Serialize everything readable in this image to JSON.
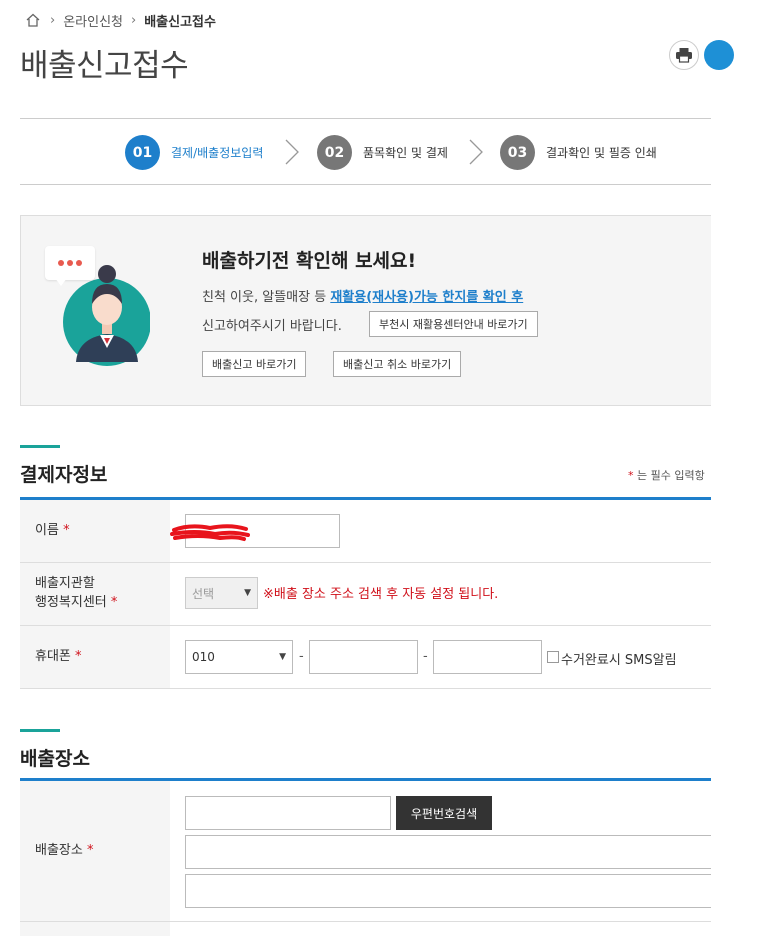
{
  "breadcrumb": {
    "home_icon": "home-icon",
    "items": [
      "온라인신청",
      "배출신고접수"
    ]
  },
  "page_title": "배출신고접수",
  "steps": [
    {
      "num": "01",
      "label": "결제/배출정보입력",
      "active": true
    },
    {
      "num": "02",
      "label": "품목확인 및 결제",
      "active": false
    },
    {
      "num": "03",
      "label": "결과확인 및 필증 인쇄",
      "active": false
    }
  ],
  "notice": {
    "title": "배출하기전 확인해 보세요!",
    "line1_prefix": "친척 이웃, 알뜰매장 등 ",
    "line1_link": "재활용(재사용)가능 한지를 확인 후",
    "line2": "신고하여주시기 바랍니다.",
    "recycle_center_button": "부천시 재활용센터안내 바로가기",
    "go_report_button": "배출신고 바로가기",
    "cancel_report_button": "배출신고 취소 바로가기"
  },
  "payer_section": {
    "title": "결제자정보",
    "required_star": "*",
    "required_note": " 는 필수 입력항",
    "name_label": "이름",
    "center_label_line1": "배출지관할",
    "center_label_line2": "행정복지센터",
    "center_select": "선택",
    "center_note": "※배출 장소 주소 검색 후 자동 설정 됩니다.",
    "phone_label": "휴대폰",
    "phone_prefix": "010",
    "dash": "-",
    "sms_label": "수거완료시 SMS알림"
  },
  "location_section": {
    "title": "배출장소",
    "location_label": "배출장소",
    "zip_search_button": "우편번호검색"
  },
  "colors": {
    "accent_blue": "#1e7fcb",
    "accent_teal": "#1aa39a",
    "required_red": "#d0101a"
  }
}
